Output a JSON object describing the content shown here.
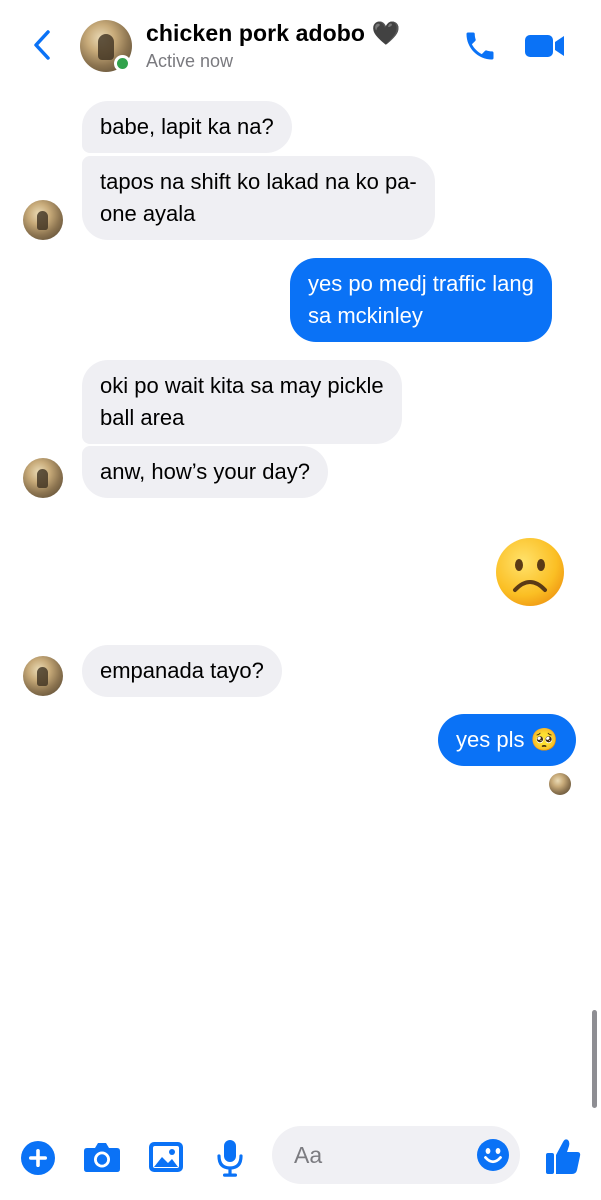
{
  "header": {
    "contact_name": "chicken pork adobo 🖤",
    "status": "Active now"
  },
  "messages": [
    {
      "side": "in",
      "lines": [
        "babe, lapit ka na?"
      ]
    },
    {
      "side": "in",
      "lines": [
        "tapos na shift ko lakad na ko pa-",
        "one ayala"
      ]
    },
    {
      "side": "out",
      "lines": [
        "yes po medj traffic lang",
        "sa mckinley"
      ]
    },
    {
      "side": "in",
      "lines": [
        "oki po wait kita sa may pickle",
        "ball area"
      ]
    },
    {
      "side": "in",
      "lines": [
        "anw, how’s your day?"
      ]
    },
    {
      "side": "out",
      "emoji": "frowning-face-emoji"
    },
    {
      "side": "in",
      "lines": [
        "empanada tayo?"
      ]
    },
    {
      "side": "out",
      "lines": [
        "yes pls 🥺"
      ]
    }
  ],
  "composer": {
    "placeholder": "Aa"
  },
  "colors": {
    "accent": "#0a72f6",
    "incoming_bubble": "#efeff3",
    "online": "#31a24c"
  }
}
